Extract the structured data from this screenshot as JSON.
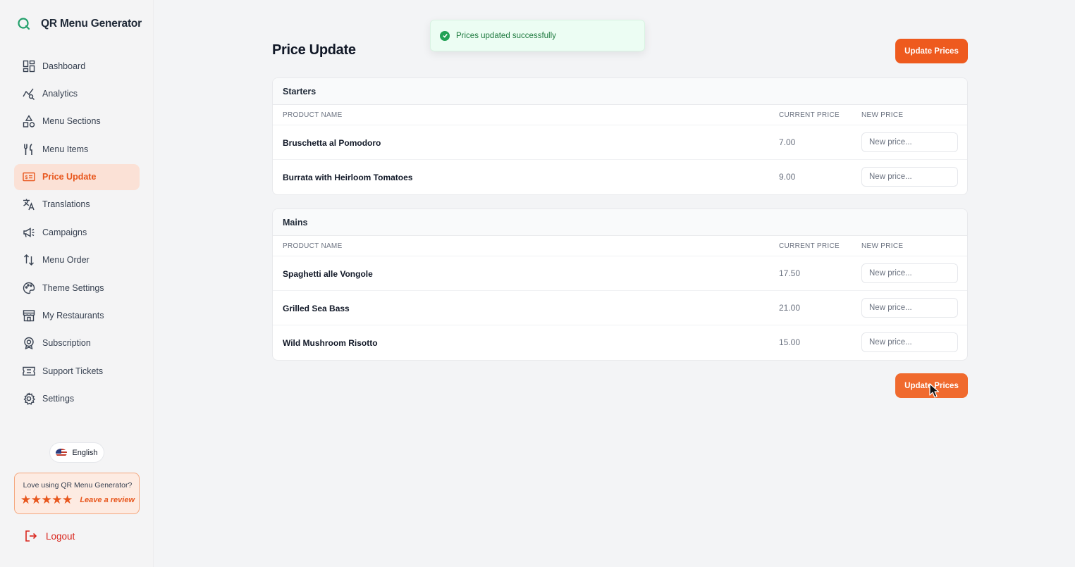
{
  "app": {
    "title": "QR Menu Generator"
  },
  "sidebar": {
    "items": [
      {
        "label": "Dashboard",
        "icon": "dashboard-icon"
      },
      {
        "label": "Analytics",
        "icon": "analytics-icon"
      },
      {
        "label": "Menu Sections",
        "icon": "shapes-icon"
      },
      {
        "label": "Menu Items",
        "icon": "utensils-icon"
      },
      {
        "label": "Price Update",
        "icon": "price-tag-icon",
        "active": true
      },
      {
        "label": "Translations",
        "icon": "translate-icon"
      },
      {
        "label": "Campaigns",
        "icon": "megaphone-icon"
      },
      {
        "label": "Menu Order",
        "icon": "sort-arrows-icon"
      },
      {
        "label": "Theme Settings",
        "icon": "palette-icon"
      },
      {
        "label": "My Restaurants",
        "icon": "store-icon"
      },
      {
        "label": "Subscription",
        "icon": "badge-icon"
      },
      {
        "label": "Support Tickets",
        "icon": "ticket-icon"
      },
      {
        "label": "Settings",
        "icon": "gear-icon"
      }
    ],
    "language": "English",
    "review": {
      "question": "Love using QR Menu Generator?",
      "stars": "★★★★★",
      "link": "Leave a review"
    },
    "logout": "Logout"
  },
  "toast": {
    "message": "Prices updated successfully"
  },
  "page": {
    "title": "Price Update",
    "update_button": "Update Prices"
  },
  "columns": {
    "product": "PRODUCT NAME",
    "current": "CURRENT PRICE",
    "new": "NEW PRICE"
  },
  "input_placeholder": "New price...",
  "sections": [
    {
      "name": "Starters",
      "items": [
        {
          "name": "Bruschetta al Pomodoro",
          "price": "7.00"
        },
        {
          "name": "Burrata with Heirloom Tomatoes",
          "price": "9.00"
        }
      ]
    },
    {
      "name": "Mains",
      "items": [
        {
          "name": "Spaghetti alle Vongole",
          "price": "17.50"
        },
        {
          "name": "Grilled Sea Bass",
          "price": "21.00"
        },
        {
          "name": "Wild Mushroom Risotto",
          "price": "15.00"
        }
      ]
    }
  ],
  "colors": {
    "accent": "#ee5a1e",
    "active_bg": "#fbe1d6",
    "success": "#22a155",
    "logout": "#d9251c"
  }
}
